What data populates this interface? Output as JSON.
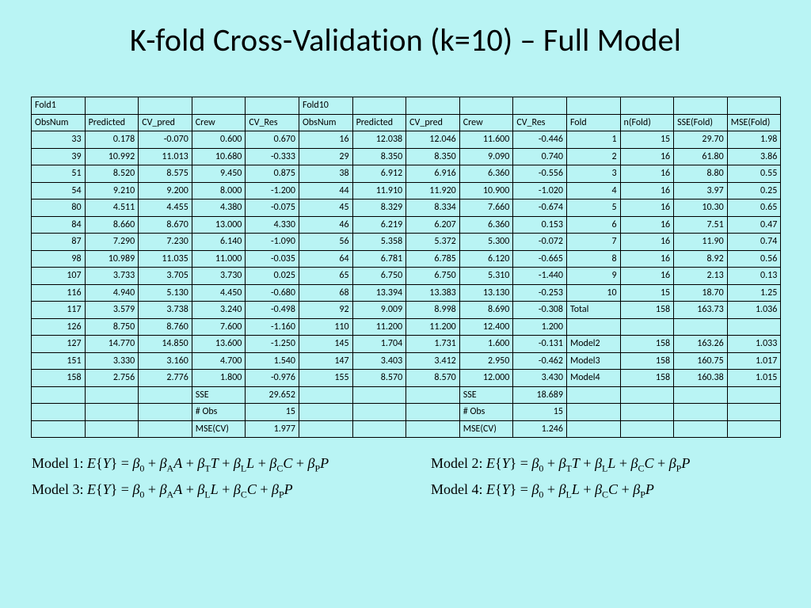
{
  "title": "K-fold Cross-Validation (k=10) – Full Model",
  "topHeader": [
    "Fold1",
    "",
    "",
    "",
    "",
    "Fold10",
    "",
    "",
    "",
    "",
    "",
    "",
    "",
    ""
  ],
  "colHeader": [
    "ObsNum",
    "Predicted",
    "CV_pred",
    "Crew",
    "CV_Res",
    "ObsNum",
    "Predicted",
    "CV_pred",
    "Crew",
    "CV_Res",
    "Fold",
    "n(Fold)",
    "SSE(Fold)",
    "MSE(Fold)"
  ],
  "rows": [
    [
      "33",
      "0.178",
      "-0.070",
      "0.600",
      "0.670",
      "16",
      "12.038",
      "12.046",
      "11.600",
      "-0.446",
      "1",
      "15",
      "29.70",
      "1.98"
    ],
    [
      "39",
      "10.992",
      "11.013",
      "10.680",
      "-0.333",
      "29",
      "8.350",
      "8.350",
      "9.090",
      "0.740",
      "2",
      "16",
      "61.80",
      "3.86"
    ],
    [
      "51",
      "8.520",
      "8.575",
      "9.450",
      "0.875",
      "38",
      "6.912",
      "6.916",
      "6.360",
      "-0.556",
      "3",
      "16",
      "8.80",
      "0.55"
    ],
    [
      "54",
      "9.210",
      "9.200",
      "8.000",
      "-1.200",
      "44",
      "11.910",
      "11.920",
      "10.900",
      "-1.020",
      "4",
      "16",
      "3.97",
      "0.25"
    ],
    [
      "80",
      "4.511",
      "4.455",
      "4.380",
      "-0.075",
      "45",
      "8.329",
      "8.334",
      "7.660",
      "-0.674",
      "5",
      "16",
      "10.30",
      "0.65"
    ],
    [
      "84",
      "8.660",
      "8.670",
      "13.000",
      "4.330",
      "46",
      "6.219",
      "6.207",
      "6.360",
      "0.153",
      "6",
      "16",
      "7.51",
      "0.47"
    ],
    [
      "87",
      "7.290",
      "7.230",
      "6.140",
      "-1.090",
      "56",
      "5.358",
      "5.372",
      "5.300",
      "-0.072",
      "7",
      "16",
      "11.90",
      "0.74"
    ],
    [
      "98",
      "10.989",
      "11.035",
      "11.000",
      "-0.035",
      "64",
      "6.781",
      "6.785",
      "6.120",
      "-0.665",
      "8",
      "16",
      "8.92",
      "0.56"
    ],
    [
      "107",
      "3.733",
      "3.705",
      "3.730",
      "0.025",
      "65",
      "6.750",
      "6.750",
      "5.310",
      "-1.440",
      "9",
      "16",
      "2.13",
      "0.13"
    ],
    [
      "116",
      "4.940",
      "5.130",
      "4.450",
      "-0.680",
      "68",
      "13.394",
      "13.383",
      "13.130",
      "-0.253",
      "10",
      "15",
      "18.70",
      "1.25"
    ],
    [
      "117",
      "3.579",
      "3.738",
      "3.240",
      "-0.498",
      "92",
      "9.009",
      "8.998",
      "8.690",
      "-0.308",
      "Total",
      "158",
      "163.73",
      "1.036"
    ],
    [
      "126",
      "8.750",
      "8.760",
      "7.600",
      "-1.160",
      "110",
      "11.200",
      "11.200",
      "12.400",
      "1.200",
      "",
      "",
      "",
      ""
    ],
    [
      "127",
      "14.770",
      "14.850",
      "13.600",
      "-1.250",
      "145",
      "1.704",
      "1.731",
      "1.600",
      "-0.131",
      "Model2",
      "158",
      "163.26",
      "1.033"
    ],
    [
      "151",
      "3.330",
      "3.160",
      "4.700",
      "1.540",
      "147",
      "3.403",
      "3.412",
      "2.950",
      "-0.462",
      "Model3",
      "158",
      "160.75",
      "1.017"
    ],
    [
      "158",
      "2.756",
      "2.776",
      "1.800",
      "-0.976",
      "155",
      "8.570",
      "8.570",
      "12.000",
      "3.430",
      "Model4",
      "158",
      "160.38",
      "1.015"
    ],
    [
      "",
      "",
      "",
      "SSE",
      "29.652",
      "",
      "",
      "",
      "SSE",
      "18.689",
      "",
      "",
      "",
      ""
    ],
    [
      "",
      "",
      "",
      "# Obs",
      "15",
      "",
      "",
      "",
      "# Obs",
      "15",
      "",
      "",
      "",
      ""
    ],
    [
      "",
      "",
      "",
      "MSE(CV)",
      "1.977",
      "",
      "",
      "",
      "MSE(CV)",
      "1.246",
      "",
      "",
      "",
      ""
    ]
  ],
  "textCols": {
    "10": true
  },
  "textCells": {
    "15.3": 1,
    "15.8": 1,
    "16.3": 1,
    "16.8": 1,
    "17.3": 1,
    "17.8": 1
  },
  "models": {
    "m1": {
      "label": "Model 1:",
      "sub": [
        "0",
        "A",
        "T",
        "L",
        "C",
        "P"
      ],
      "vars": [
        "",
        "A",
        "T",
        "L",
        "C",
        "P"
      ]
    },
    "m2": {
      "label": "Model 2:",
      "sub": [
        "0",
        "T",
        "L",
        "C",
        "P"
      ],
      "vars": [
        "",
        "T",
        "L",
        "C",
        "P"
      ]
    },
    "m3": {
      "label": "Model 3:",
      "sub": [
        "0",
        "A",
        "L",
        "C",
        "P"
      ],
      "vars": [
        "",
        "A",
        "L",
        "C",
        "P"
      ]
    },
    "m4": {
      "label": "Model 4:",
      "sub": [
        "0",
        "L",
        "C",
        "P"
      ],
      "vars": [
        "",
        "L",
        "C",
        "P"
      ]
    }
  }
}
